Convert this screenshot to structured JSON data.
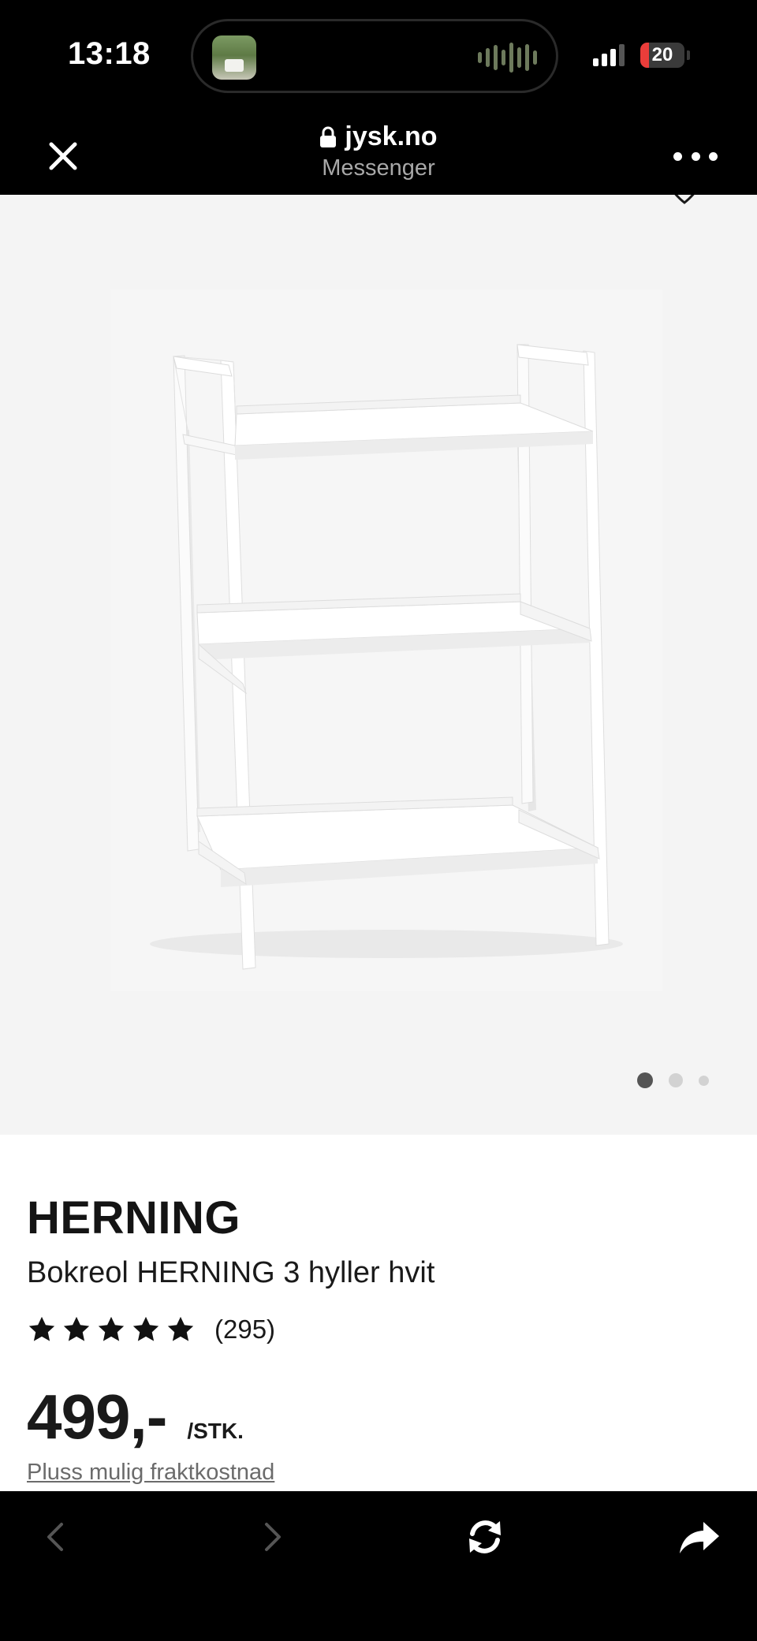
{
  "status_bar": {
    "time": "13:18",
    "battery_level": "20",
    "battery_color": "#ea3d3a",
    "signal_bars": 3
  },
  "browser": {
    "domain": "jysk.no",
    "subtitle": "Messenger",
    "icons": {
      "close": "close-icon",
      "lock": "lock-icon",
      "more": "more-icon"
    }
  },
  "gallery": {
    "image_count": 3,
    "active_index": 0
  },
  "product": {
    "brand": "HERNING",
    "name": "Bokreol HERNING 3 hyller hvit",
    "rating_stars": 5,
    "review_count": "(295)",
    "price": "499,-",
    "unit": "/STK.",
    "shipping_note": "Pluss mulig fraktkostnad"
  },
  "toolbar": {
    "icons": [
      "back-icon",
      "forward-icon",
      "reload-icon",
      "share-icon"
    ]
  }
}
